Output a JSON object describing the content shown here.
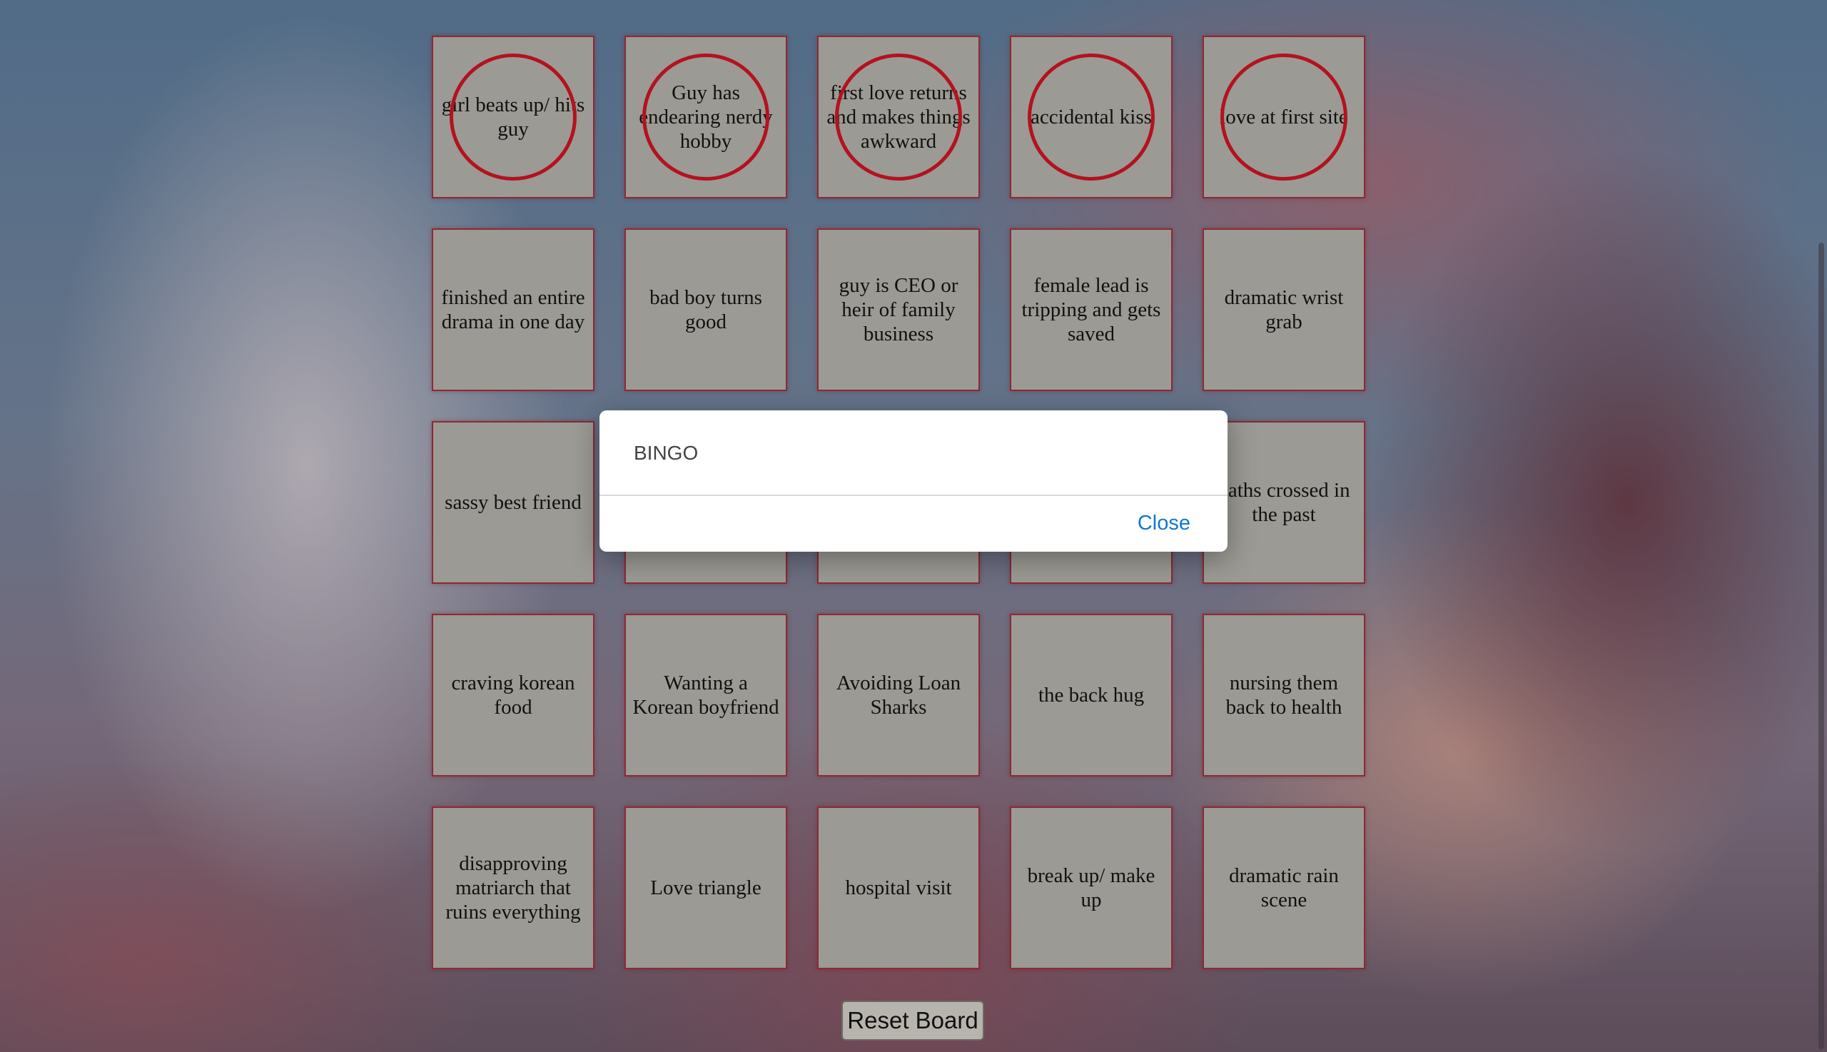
{
  "board": {
    "cells": [
      {
        "text": "girl beats up/ hits guy",
        "marked": true
      },
      {
        "text": "Guy has endearing nerdy hobby",
        "marked": true
      },
      {
        "text": "first love returns and makes things awkward",
        "marked": true
      },
      {
        "text": "accidental kiss",
        "marked": true
      },
      {
        "text": "love at first site",
        "marked": true
      },
      {
        "text": "finished an entire drama in one day",
        "marked": false
      },
      {
        "text": "bad boy turns good",
        "marked": false
      },
      {
        "text": "guy is CEO or heir of family business",
        "marked": false
      },
      {
        "text": "female lead is tripping and gets saved",
        "marked": false
      },
      {
        "text": "dramatic wrist grab",
        "marked": false
      },
      {
        "text": "sassy best friend",
        "marked": false
      },
      {
        "text": "",
        "marked": false
      },
      {
        "text": "",
        "marked": false
      },
      {
        "text": "",
        "marked": false
      },
      {
        "text": "paths crossed in the past",
        "marked": false
      },
      {
        "text": "craving korean food",
        "marked": false
      },
      {
        "text": "Wanting a Korean boyfriend",
        "marked": false
      },
      {
        "text": "Avoiding Loan Sharks",
        "marked": false
      },
      {
        "text": "the back hug",
        "marked": false
      },
      {
        "text": "nursing them back to health",
        "marked": false
      },
      {
        "text": "disapproving matriarch that ruins everything",
        "marked": false
      },
      {
        "text": "Love triangle",
        "marked": false
      },
      {
        "text": "hospital visit",
        "marked": false
      },
      {
        "text": "break up/ make up",
        "marked": false
      },
      {
        "text": "dramatic rain scene",
        "marked": false
      }
    ]
  },
  "reset_button": {
    "label": "Reset Board"
  },
  "dialog": {
    "message": "BINGO",
    "close_label": "Close",
    "close_color": "#1276d4"
  },
  "colors": {
    "cell_background": "#9c9a94",
    "cell_border": "#8a2a35",
    "mark_circle": "#b3121f"
  }
}
